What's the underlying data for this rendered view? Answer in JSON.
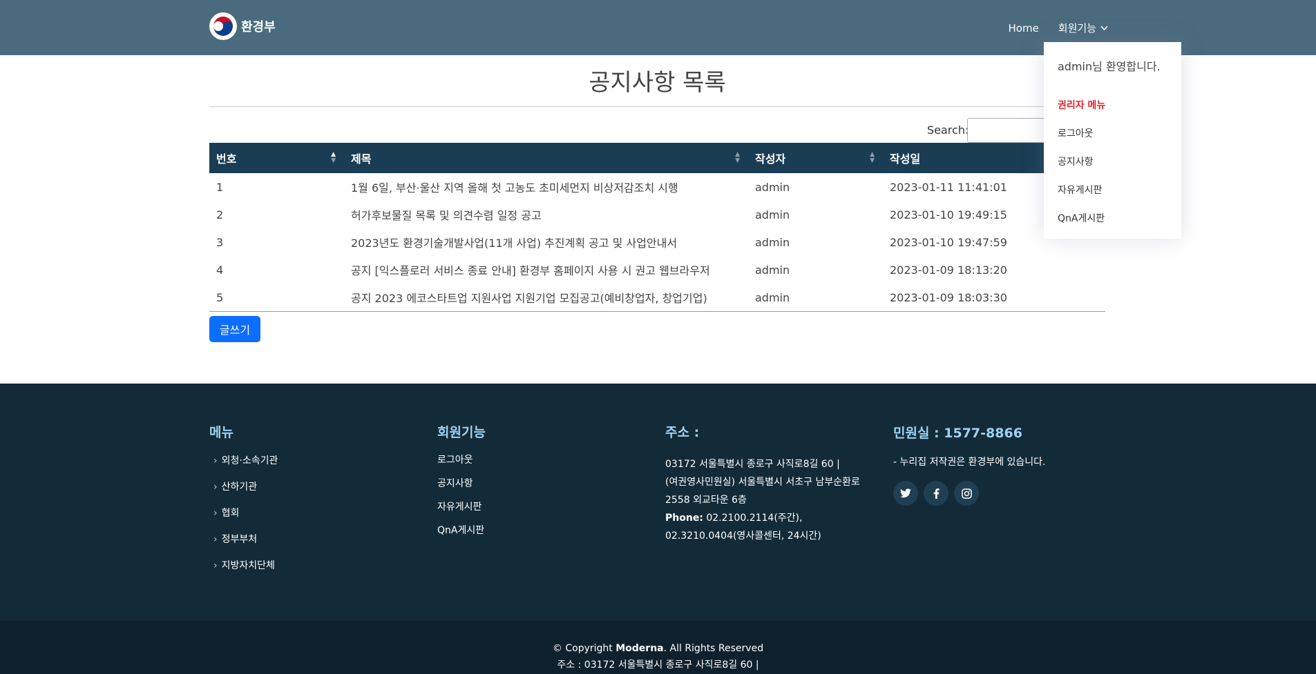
{
  "header": {
    "logo_text": "환경부",
    "nav": {
      "home": "Home",
      "member_menu": "회원기능"
    }
  },
  "dropdown": {
    "welcome": "admin님 환영합니다.",
    "items": [
      "권리자 메뉴",
      "로그아웃",
      "공지사항",
      "자유게시판",
      "QnA게시판"
    ]
  },
  "page": {
    "title": "공지사항 목록",
    "search_label": "Search:",
    "search_value": ""
  },
  "table": {
    "headers": [
      "번호",
      "제목",
      "작성자",
      "작성일"
    ],
    "rows": [
      {
        "no": "1",
        "title": "1월 6일, 부산·울산 지역 올해 첫 고농도 초미세먼지 비상저감조치 시행",
        "author": "admin",
        "date": "2023-01-11 11:41:01"
      },
      {
        "no": "2",
        "title": "허가후보물질 목록 및 의견수렴 일정 공고",
        "author": "admin",
        "date": "2023-01-10 19:49:15"
      },
      {
        "no": "3",
        "title": "2023년도 환경기술개발사업(11개 사업) 추진계획 공고 및 사업안내서",
        "author": "admin",
        "date": "2023-01-10 19:47:59"
      },
      {
        "no": "4",
        "title": "공지 [익스플로러 서비스 종료 안내] 환경부 홈페이지 사용 시 권고 웹브라우저",
        "author": "admin",
        "date": "2023-01-09 18:13:20"
      },
      {
        "no": "5",
        "title": "공지 2023 에코스타트업 지원사업 지원기업 모집공고(예비창업자, 창업기업)",
        "author": "admin",
        "date": "2023-01-09 18:03:30"
      }
    ]
  },
  "write_button": "글쓰기",
  "footer": {
    "menu": {
      "title": "메뉴",
      "items": [
        "외청·소속기관",
        "산하기관",
        "협회",
        "정부부처",
        "지방자치단체"
      ]
    },
    "member": {
      "title": "회원기능",
      "items": [
        "로그아웃",
        "공지사항",
        "자유게시판",
        "QnA게시판"
      ]
    },
    "address": {
      "title": "주소 :",
      "line1": "03172 서울특별시 종로구 사직로8길 60 |",
      "line2": "(여권영사민원실) 서울특별시 서초구 남부순환로",
      "line3": "2558 외교타운 6층",
      "phone_label": "Phone:",
      "phone1": " 02.2100.2114(주간),",
      "phone2": "02.3210.0404(영사콜센터, 24시간)"
    },
    "contact": {
      "title": "민원실 : 1577-8866",
      "copyright_note": "- 누리집 저작권은 환경부에 있습니다."
    },
    "social": [
      "twitter-icon",
      "facebook-icon",
      "instagram-icon"
    ]
  },
  "bottom": {
    "copyright_prefix": "© Copyright ",
    "brand": "Moderna",
    "copyright_suffix": ". All Rights Reserved",
    "address": "주소 : 03172 서울특별시 종로구 사직로8길 60 |"
  }
}
